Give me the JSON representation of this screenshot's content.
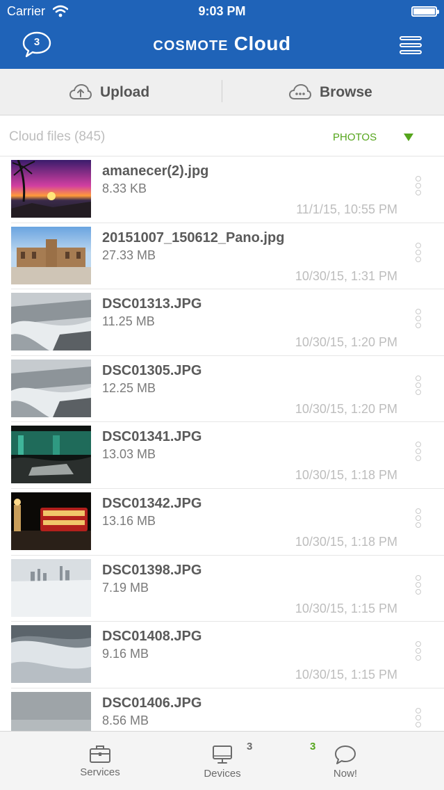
{
  "status_bar": {
    "carrier": "Carrier",
    "time": "9:03 PM"
  },
  "header": {
    "notification_count": "3",
    "title_brand": "cosmote",
    "title_rest": " Cloud",
    "brand_color": "#1f63b8"
  },
  "actions": {
    "upload_label": "Upload",
    "browse_label": "Browse"
  },
  "filter": {
    "count_label": "Cloud files (845)",
    "type_label": "PHOTOS",
    "accent_color": "#55a51c"
  },
  "files": [
    {
      "name": "amanecer(2).jpg",
      "size": "8.33 KB",
      "date": "11/1/15, 10:55 PM",
      "thumb": "sunset"
    },
    {
      "name": "20151007_150612_Pano.jpg",
      "size": "27.33 MB",
      "date": "10/30/15, 1:31 PM",
      "thumb": "plaza"
    },
    {
      "name": "DSC01313.JPG",
      "size": "11.25 MB",
      "date": "10/30/15, 1:20 PM",
      "thumb": "falls"
    },
    {
      "name": "DSC01305.JPG",
      "size": "12.25 MB",
      "date": "10/30/15, 1:20 PM",
      "thumb": "falls"
    },
    {
      "name": "DSC01341.JPG",
      "size": "13.03 MB",
      "date": "10/30/15, 1:18 PM",
      "thumb": "night-falls"
    },
    {
      "name": "DSC01342.JPG",
      "size": "13.16 MB",
      "date": "10/30/15, 1:18 PM",
      "thumb": "bus"
    },
    {
      "name": "DSC01398.JPG",
      "size": "7.19 MB",
      "date": "10/30/15, 1:15 PM",
      "thumb": "mist"
    },
    {
      "name": "DSC01408.JPG",
      "size": "9.16 MB",
      "date": "10/30/15, 1:15 PM",
      "thumb": "ice"
    },
    {
      "name": "DSC01406.JPG",
      "size": "8.56 MB",
      "date": "",
      "thumb": "grey"
    }
  ],
  "tabbar": {
    "services_label": "Services",
    "devices_label": "Devices",
    "devices_badge": "3",
    "now_label": "Now!",
    "now_badge": "3"
  }
}
